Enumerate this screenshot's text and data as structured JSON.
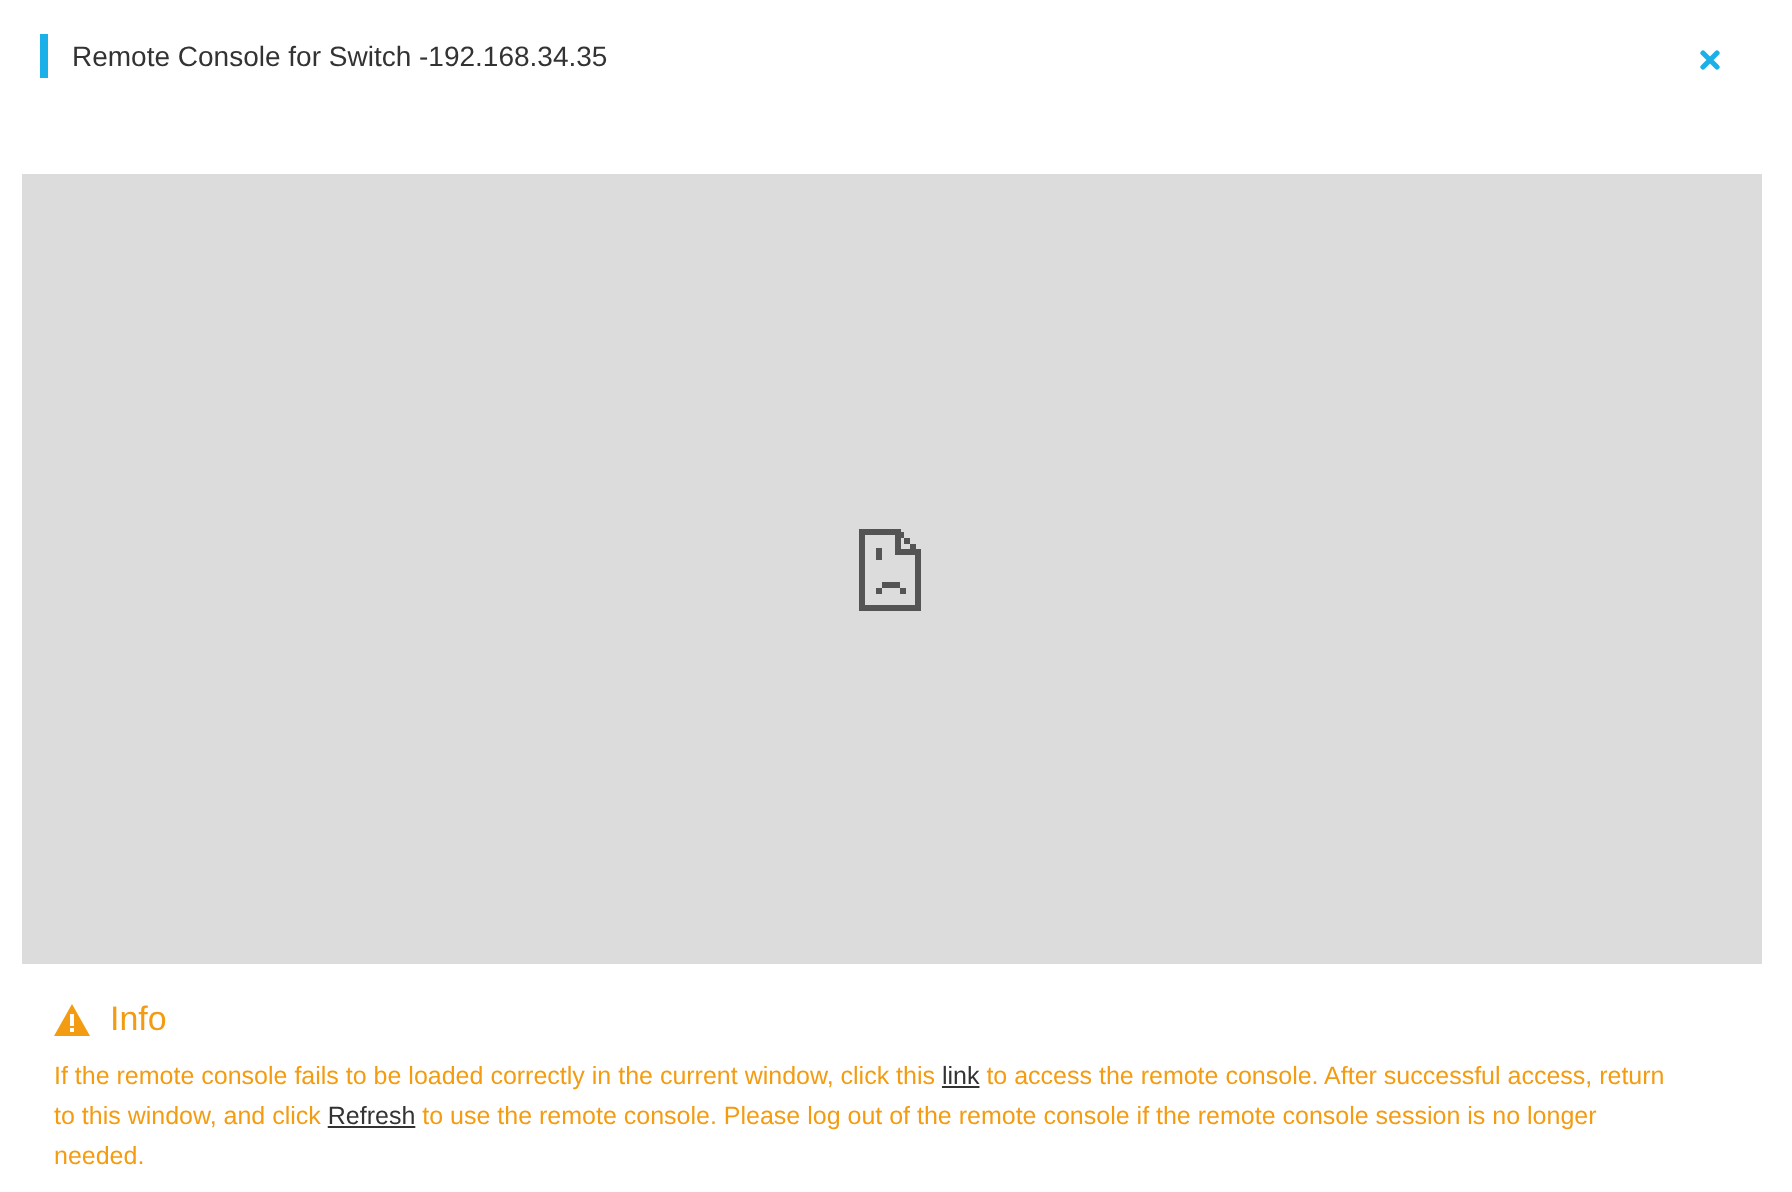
{
  "dialog": {
    "title": "Remote Console for Switch -192.168.34.35"
  },
  "console": {
    "load_failed": true
  },
  "info": {
    "heading": "Info",
    "message": [
      {
        "kind": "text",
        "text": "If the remote console fails to be loaded correctly in the current window, click this "
      },
      {
        "kind": "link",
        "text": "link"
      },
      {
        "kind": "text",
        "text": " to access the remote console. After successful access, return to this window, and click "
      },
      {
        "kind": "link",
        "text": "Refresh"
      },
      {
        "kind": "text",
        "text": " to use the remote console. Please log out of the remote console if the remote console session is no longer needed."
      }
    ]
  }
}
